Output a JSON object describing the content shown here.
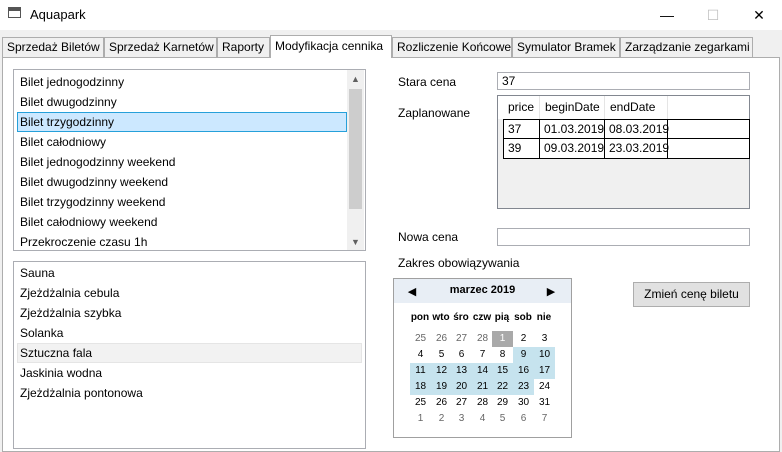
{
  "window": {
    "title": "Aquapark",
    "minimize": "—",
    "maximize": "☐",
    "close": "✕"
  },
  "tabs": [
    {
      "label": "Sprzedaż Biletów"
    },
    {
      "label": "Sprzedaż Karnetów"
    },
    {
      "label": "Raporty"
    },
    {
      "label": "Modyfikacja cennika"
    },
    {
      "label": "Rozliczenie Końcowe"
    },
    {
      "label": "Symulator Bramek"
    },
    {
      "label": "Zarządzanie zegarkami"
    }
  ],
  "active_tab": "Modyfikacja cennika",
  "tickets": [
    {
      "label": "Bilet jednogodzinny"
    },
    {
      "label": "Bilet dwugodzinny"
    },
    {
      "label": "Bilet trzygodzinny"
    },
    {
      "label": "Bilet całodniowy"
    },
    {
      "label": "Bilet jednogodzinny weekend"
    },
    {
      "label": "Bilet dwugodzinny weekend"
    },
    {
      "label": "Bilet trzygodzinny weekend"
    },
    {
      "label": "Bilet całodniowy weekend"
    },
    {
      "label": "Przekroczenie czasu 1h"
    }
  ],
  "selected_ticket": "Bilet trzygodzinny",
  "attractions": [
    {
      "label": "Sauna"
    },
    {
      "label": "Zjeżdżalnia cebula"
    },
    {
      "label": "Zjeżdżalnia szybka"
    },
    {
      "label": "Solanka"
    },
    {
      "label": "Sztuczna fala"
    },
    {
      "label": "Jaskinia wodna"
    },
    {
      "label": "Zjeżdżalnia pontonowa"
    }
  ],
  "highlighted_attraction": "Sztuczna fala",
  "old_price": {
    "label": "Stara cena",
    "value": "37"
  },
  "scheduled": {
    "label": "Zaplanowane",
    "columns": [
      "price",
      "beginDate",
      "endDate"
    ],
    "rows": [
      [
        "37",
        "01.03.2019",
        "08.03.2019"
      ],
      [
        "39",
        "09.03.2019",
        "23.03.2019"
      ]
    ]
  },
  "new_price": {
    "label": "Nowa cena",
    "value": ""
  },
  "validity": {
    "label": "Zakres obowiązywania",
    "month": "marzec 2019",
    "prev": "◀",
    "next": "▶",
    "weekdays": [
      "pon",
      "wto",
      "śro",
      "czw",
      "pią",
      "sob",
      "nie"
    ],
    "weeks": [
      [
        "25",
        "26",
        "27",
        "28",
        "1",
        "2",
        "3"
      ],
      [
        "4",
        "5",
        "6",
        "7",
        "8",
        "9",
        "10"
      ],
      [
        "11",
        "12",
        "13",
        "14",
        "15",
        "16",
        "17"
      ],
      [
        "18",
        "19",
        "20",
        "21",
        "22",
        "23",
        "24"
      ],
      [
        "25",
        "26",
        "27",
        "28",
        "29",
        "30",
        "31"
      ],
      [
        "1",
        "2",
        "3",
        "4",
        "5",
        "6",
        "7"
      ]
    ],
    "today": "1",
    "selection": [
      "9",
      "23"
    ]
  },
  "change_button": {
    "label": "Zmień cenę biletu"
  }
}
